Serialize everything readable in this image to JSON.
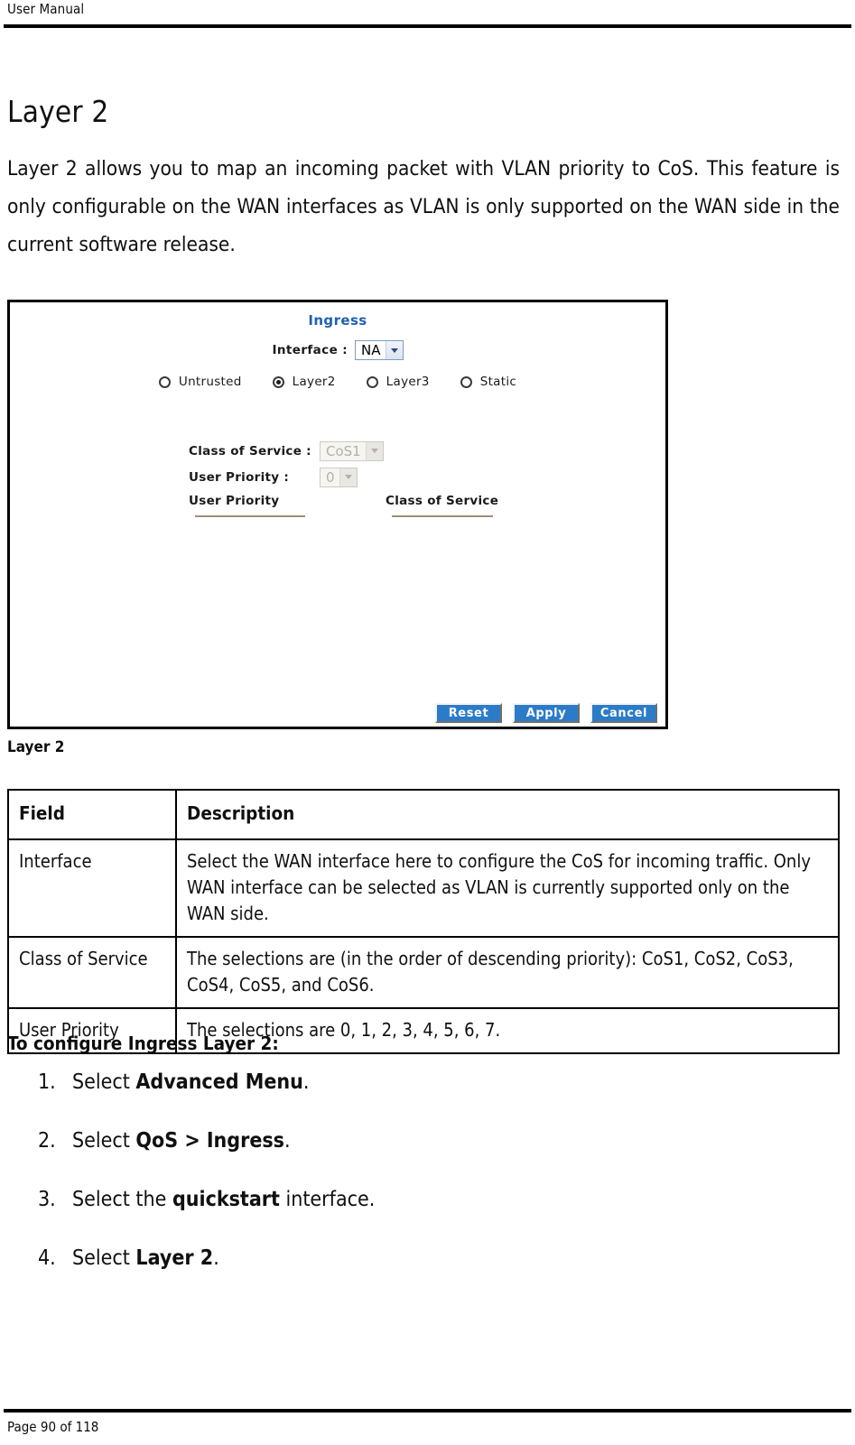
{
  "running_header": {
    "text": "User Manual"
  },
  "heading": "Layer 2",
  "intro_paragraph": "Layer 2 allows you to map an incoming packet with VLAN priority to CoS. This feature is only configurable on the WAN interfaces as VLAN is only supported on the WAN side in the current software release.",
  "screenshot": {
    "title": "Ingress",
    "interface": {
      "label": "Interface :",
      "value": "NA"
    },
    "modes": [
      {
        "label": "Untrusted",
        "selected": false
      },
      {
        "label": "Layer2",
        "selected": true
      },
      {
        "label": "Layer3",
        "selected": false
      },
      {
        "label": "Static",
        "selected": false
      }
    ],
    "class_of_service": {
      "label": "Class of Service :",
      "value": "CoS1",
      "disabled": true
    },
    "user_priority": {
      "label": "User Priority :",
      "value": "0",
      "disabled": true
    },
    "table_headers": {
      "user_priority": "User Priority",
      "class_of_service": "Class of Service"
    },
    "buttons": {
      "reset": "Reset",
      "apply": "Apply",
      "cancel": "Cancel"
    },
    "colors": {
      "title": "#2161b0",
      "button_bg": "#2b7bc8",
      "rule": "#9c8f76"
    }
  },
  "figure_caption": "Layer 2",
  "table": {
    "headers": {
      "field": "Field",
      "description": "Description"
    },
    "rows": [
      {
        "field": "Interface",
        "description": "Select the WAN interface here to configure the CoS for incoming traffic. Only WAN interface can be selected as VLAN is currently supported only on the WAN side."
      },
      {
        "field": "Class of Service",
        "description": "The selections are (in the order of descending priority): CoS1, CoS2, CoS3, CoS4, CoS5, and CoS6."
      },
      {
        "field": "User Priority",
        "description": "The selections are 0, 1, 2, 3, 4, 5, 6, 7."
      }
    ]
  },
  "procedure": {
    "title": "To configure Ingress Layer 2:",
    "steps": [
      {
        "num": "1.",
        "pre": "Select ",
        "bold": "Advanced Menu",
        "post": "."
      },
      {
        "num": "2.",
        "pre": "Select ",
        "bold": "QoS > Ingress",
        "post": "."
      },
      {
        "num": "3.",
        "pre": "Select the ",
        "bold": "quickstart",
        "post": " interface."
      },
      {
        "num": "4.",
        "pre": "Select ",
        "bold": "Layer 2",
        "post": "."
      }
    ]
  },
  "footer": {
    "text": "Page 90 of 118"
  }
}
